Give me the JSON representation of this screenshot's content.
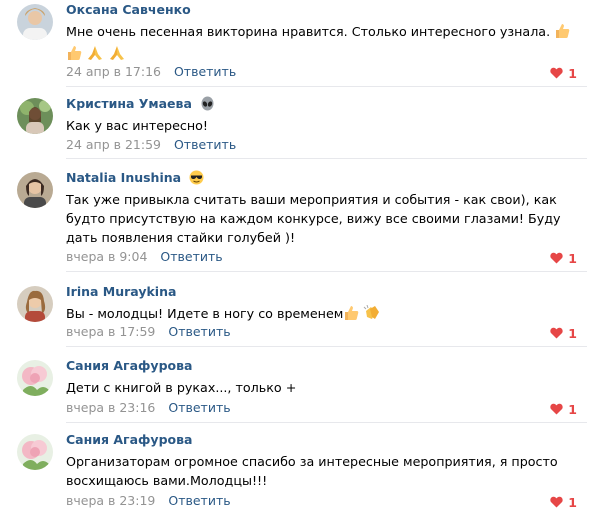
{
  "comments": [
    {
      "author": "Оксана Савченко",
      "text": "Мне очень песенная викторина нравится. Столько интересного узнала.",
      "date": "24 апр в 17:16",
      "reply": "Ответить",
      "likes": "1",
      "author_emoji": "",
      "text_emojis": [
        "thumbs-up",
        "thumbs-up",
        "praying-hands",
        "praying-hands"
      ]
    },
    {
      "author": "Кристина Умаева",
      "text": "Как у вас интересно!",
      "date": "24 апр в 21:59",
      "reply": "Ответить",
      "likes": "",
      "author_emoji": "alien",
      "text_emojis": []
    },
    {
      "author": "Natalia Inushina",
      "text": "Так уже привыкла считать ваши мероприятия и события - как свои), как будто присутствую на каждом конкурсе, вижу все своими глазами! Буду дать появления стайки голубей )!",
      "date": "вчера в 9:04",
      "reply": "Ответить",
      "likes": "1",
      "author_emoji": "sunglasses",
      "text_emojis": []
    },
    {
      "author": "Irina Muraykina",
      "text": "Вы - молодцы! Идете в ногу со временем",
      "date": "вчера в 17:59",
      "reply": "Ответить",
      "likes": "1",
      "author_emoji": "",
      "text_emojis": [
        "thumbs-up",
        "clapping-hands"
      ]
    },
    {
      "author": "Сания Агафурова",
      "text": "Дети с книгой в руках..., только +",
      "date": "вчера в 23:16",
      "reply": "Ответить",
      "likes": "1",
      "author_emoji": "",
      "text_emojis": []
    },
    {
      "author": "Сания Агафурова",
      "text": "Организаторам огромное спасибо за интересные мероприятия, я просто восхищаюсь вами.Молодцы!!!",
      "date": "вчера в 23:19",
      "reply": "Ответить",
      "likes": "1",
      "author_emoji": "",
      "text_emojis": []
    }
  ],
  "colors": {
    "author": "#2a5885",
    "date": "#939393",
    "like": "#e64646",
    "separator": "#e7e8ec"
  }
}
